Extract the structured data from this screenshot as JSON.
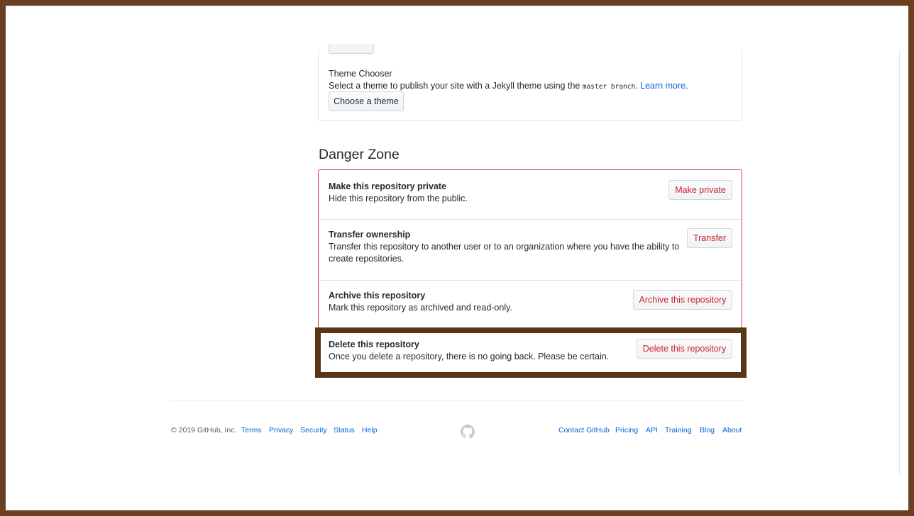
{
  "pages": {
    "theme_title": "Theme Chooser",
    "theme_desc_prefix": "Select a theme to publish your site with a Jekyll theme using the ",
    "theme_desc_code": "master branch",
    "theme_desc_suffix": ". ",
    "learn_more": "Learn more",
    "theme_desc_end": ".",
    "choose_theme_button": "Choose a theme"
  },
  "danger_zone": {
    "title": "Danger Zone",
    "rows": [
      {
        "title": "Make this repository private",
        "description": "Hide this repository from the public.",
        "button": "Make private"
      },
      {
        "title": "Transfer ownership",
        "description": "Transfer this repository to another user or to an organization where you have the ability to create repositories.",
        "button": "Transfer"
      },
      {
        "title": "Archive this repository",
        "description": "Mark this repository as archived and read-only.",
        "button": "Archive this repository"
      },
      {
        "title": "Delete this repository",
        "description": "Once you delete a repository, there is no going back. Please be certain.",
        "button": "Delete this repository"
      }
    ]
  },
  "footer": {
    "copyright": "© 2019 GitHub, Inc.",
    "left_links": [
      "Terms",
      "Privacy",
      "Security",
      "Status",
      "Help"
    ],
    "right_links": [
      "Contact GitHub",
      "Pricing",
      "API",
      "Training",
      "Blog",
      "About"
    ],
    "logo_icon": "github-octocat-icon"
  },
  "colors": {
    "danger": "#cb2431",
    "danger_border": "#d73a49",
    "link": "#0366d6",
    "highlight_frame": "#5a3617"
  }
}
